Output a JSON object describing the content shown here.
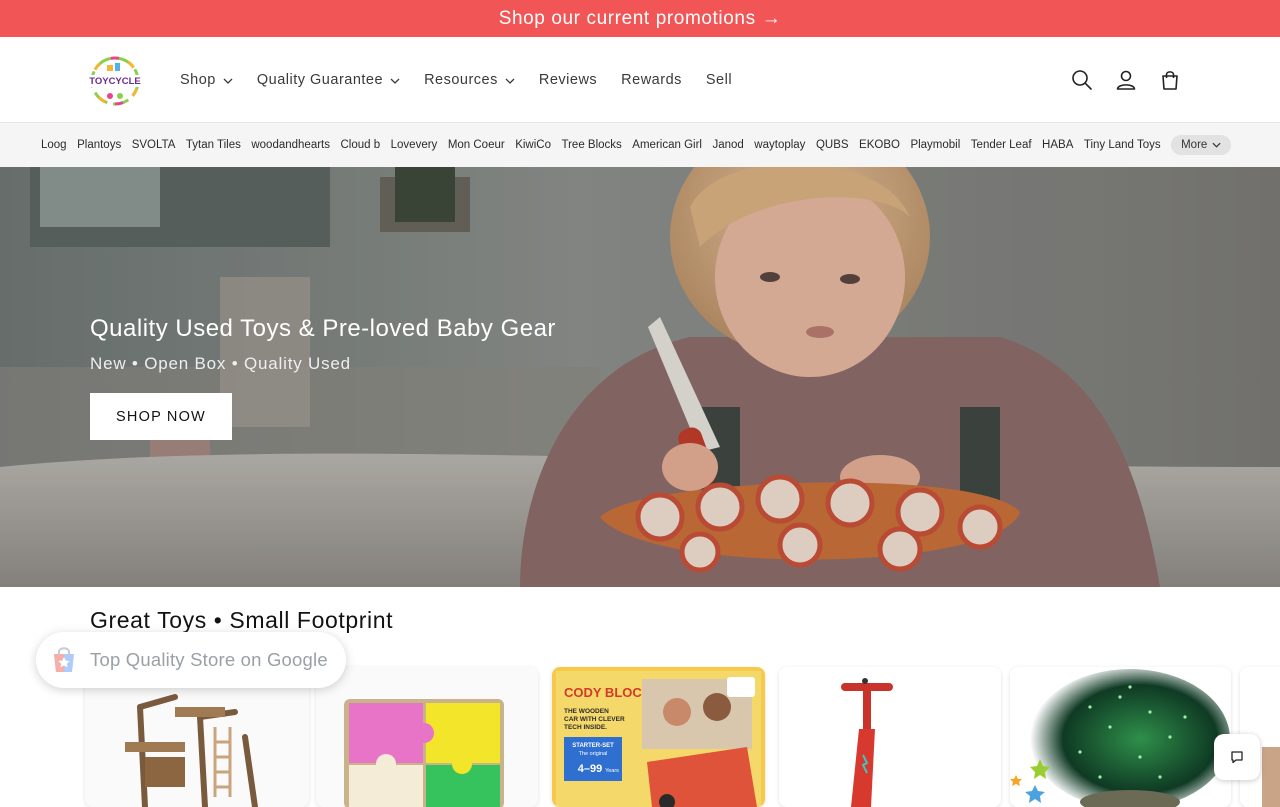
{
  "announcement": {
    "text": "Shop our current promotions",
    "arrow": "→"
  },
  "header": {
    "logo_text": "TOYCYCLE",
    "nav": [
      {
        "label": "Shop",
        "dropdown": true
      },
      {
        "label": "Quality Guarantee",
        "dropdown": true
      },
      {
        "label": "Resources",
        "dropdown": true
      },
      {
        "label": "Reviews",
        "dropdown": false
      },
      {
        "label": "Rewards",
        "dropdown": false
      },
      {
        "label": "Sell",
        "dropdown": false
      }
    ],
    "icons": [
      "search-icon",
      "account-icon",
      "cart-icon"
    ]
  },
  "brands": {
    "items": [
      "Loog",
      "Plantoys",
      "SVOLTA",
      "Tytan Tiles",
      "woodandhearts",
      "Cloud b",
      "Lovevery",
      "Mon Coeur",
      "KiwiCo",
      "Tree Blocks",
      "American Girl",
      "Janod",
      "waytoplay",
      "QUBS",
      "EKOBO",
      "Playmobil",
      "Tender Leaf",
      "HABA",
      "Tiny Land Toys"
    ],
    "more_label": "More"
  },
  "hero": {
    "title": "Quality Used Toys & Pre-loved Baby Gear",
    "subtitle": "New • Open Box • Quality Used",
    "cta": "SHOP NOW"
  },
  "section": {
    "title": "Great Toys • Small Footprint"
  },
  "products": [
    {
      "image": "wooden-tree-house"
    },
    {
      "image": "wooden-puzzle"
    },
    {
      "image": "cody-block-box",
      "box_title": "CODY BLOCK",
      "box_lines": [
        "THE WOODEN",
        "CAR WITH CLEVER",
        "TECH INSIDE."
      ],
      "box_badge_1": "STARTER-SET",
      "box_badge_2": "The original",
      "box_badge_3": "4–99",
      "box_badge_4": "Years"
    },
    {
      "image": "red-scooter"
    },
    {
      "image": "star-projector"
    },
    {
      "image": "partial-product"
    }
  ],
  "google_badge": {
    "text": "Top Quality Store on Google"
  },
  "colors": {
    "announcement": "#f25555",
    "brandbar": "#f5f5f5",
    "text": "#121212"
  }
}
